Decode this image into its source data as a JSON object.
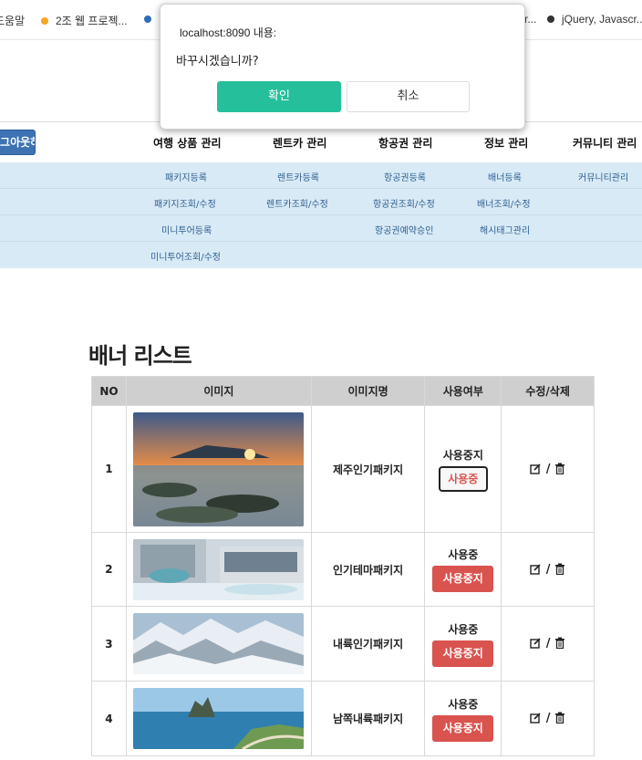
{
  "bookmarks": [
    {
      "label": "도움말",
      "dot": ""
    },
    {
      "label": "2조 웹 프로젝...",
      "dot": "#f5a623"
    },
    {
      "label": "",
      "dot": "#2a6db5"
    },
    {
      "label": "r...",
      "dot": ""
    },
    {
      "label": "jQuery, Javascr...",
      "dot": "#333333"
    }
  ],
  "nav": {
    "logout_label": "로그아웃하기",
    "menus": [
      {
        "label": "여행 상품 관리",
        "items": [
          "패키지등록",
          "패키지조회/수정",
          "미니투어등록",
          "미니투어조회/수정"
        ]
      },
      {
        "label": "렌트카 관리",
        "items": [
          "렌트카등록",
          "렌트카조회/수정"
        ]
      },
      {
        "label": "항공권 관리",
        "items": [
          "항공권등록",
          "항공권조회/수정",
          "항공권예약승인"
        ]
      },
      {
        "label": "정보 관리",
        "items": [
          "배너등록",
          "배너조회/수정",
          "해시태그관리"
        ]
      },
      {
        "label": "커뮤니티 관리",
        "items": [
          "커뮤니티관리"
        ]
      }
    ]
  },
  "page": {
    "title": "배너 리스트"
  },
  "table": {
    "headers": [
      "NO",
      "이미지",
      "이미지명",
      "사용여부",
      "수정/삭제"
    ],
    "rows": [
      {
        "no": "1",
        "name": "제주인기패키지",
        "status": "사용중지",
        "button": "사용중",
        "button_style": "outline"
      },
      {
        "no": "2",
        "name": "인기테마패키지",
        "status": "사용중",
        "button": "사용중지",
        "button_style": "red"
      },
      {
        "no": "3",
        "name": "내륙인기패키지",
        "status": "사용중",
        "button": "사용중지",
        "button_style": "red"
      },
      {
        "no": "4",
        "name": "남쪽내륙패키지",
        "status": "사용중",
        "button": "사용중지",
        "button_style": "red"
      }
    ],
    "edit_separator": "/"
  },
  "dialog": {
    "origin": "localhost:8090 내용:",
    "message": "바꾸시겠습니까?",
    "ok_label": "확인",
    "cancel_label": "취소"
  },
  "colors": {
    "ok_button": "#26bf9b",
    "danger": "#d9534f",
    "nav_sub_bg": "#d8eaf6",
    "logout_btn": "#3d73b3"
  }
}
